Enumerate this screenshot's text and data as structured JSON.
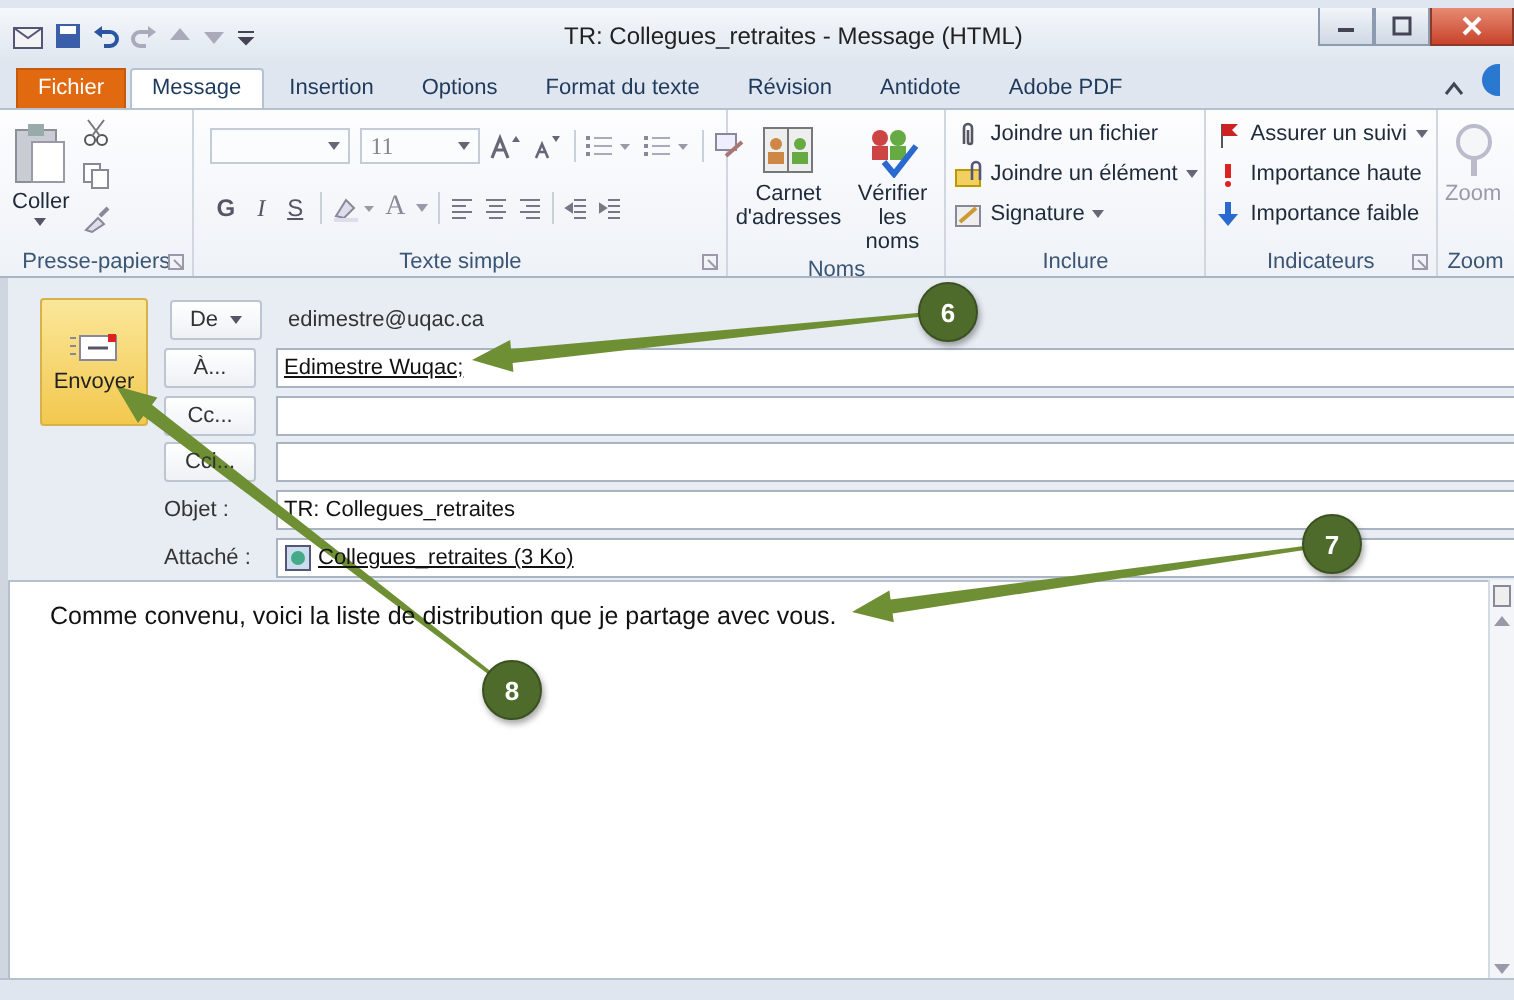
{
  "window": {
    "title": "TR: Collegues_retraites  -  Message (HTML)"
  },
  "tabs": [
    {
      "label": "Fichier",
      "kind": "file",
      "selected": false
    },
    {
      "label": "Message",
      "kind": "tab",
      "selected": true
    },
    {
      "label": "Insertion",
      "kind": "tab",
      "selected": false
    },
    {
      "label": "Options",
      "kind": "tab",
      "selected": false
    },
    {
      "label": "Format du texte",
      "kind": "tab",
      "selected": false
    },
    {
      "label": "Révision",
      "kind": "tab",
      "selected": false
    },
    {
      "label": "Antidote",
      "kind": "tab",
      "selected": false
    },
    {
      "label": "Adobe PDF",
      "kind": "tab",
      "selected": false
    }
  ],
  "ribbon": {
    "clipboard": {
      "label": "Presse-papiers",
      "paste": "Coller"
    },
    "font": {
      "label": "Texte simple",
      "size": "11",
      "bold": "G",
      "italic": "I",
      "strike": "S",
      "color_button": "A"
    },
    "names": {
      "label": "Noms",
      "buttons": [
        "Carnet d'adresses",
        "Vérifier les noms"
      ]
    },
    "include": {
      "label": "Inclure",
      "items": [
        {
          "text": "Joindre un fichier",
          "kind": "file",
          "dropdown": false
        },
        {
          "text": "Joindre un élément",
          "kind": "item",
          "dropdown": true
        },
        {
          "text": "Signature",
          "kind": "signature",
          "dropdown": true
        }
      ]
    },
    "tags": {
      "label": "Indicateurs",
      "items": [
        {
          "text": "Assurer un suivi",
          "kind": "flag",
          "dropdown": true
        },
        {
          "text": "Importance haute",
          "kind": "high",
          "dropdown": false
        },
        {
          "text": "Importance faible",
          "kind": "low",
          "dropdown": false
        }
      ]
    },
    "zoom": {
      "label": "Zoom",
      "button": "Zoom"
    }
  },
  "send": "Envoyer",
  "header": [
    {
      "kind": "sender",
      "button": "De",
      "value": "edimestre@uqac.ca"
    },
    {
      "kind": "recipient",
      "button": "À...",
      "value": "Edimestre Wuqac;"
    },
    {
      "kind": "recipient",
      "button": "Cc..."
    },
    {
      "kind": "recipient",
      "button": "Cci..."
    },
    {
      "kind": "subject",
      "label": "Objet :",
      "value": "TR: Collegues_retraites"
    },
    {
      "kind": "attachment",
      "label": "Attaché :",
      "value": "Collegues_retraites (3 Ko)"
    }
  ],
  "body": "Comme convenu, voici la liste de distribution que je partage avec vous.",
  "callouts": [
    {
      "label": "6"
    },
    {
      "label": "7"
    },
    {
      "label": "8"
    }
  ]
}
